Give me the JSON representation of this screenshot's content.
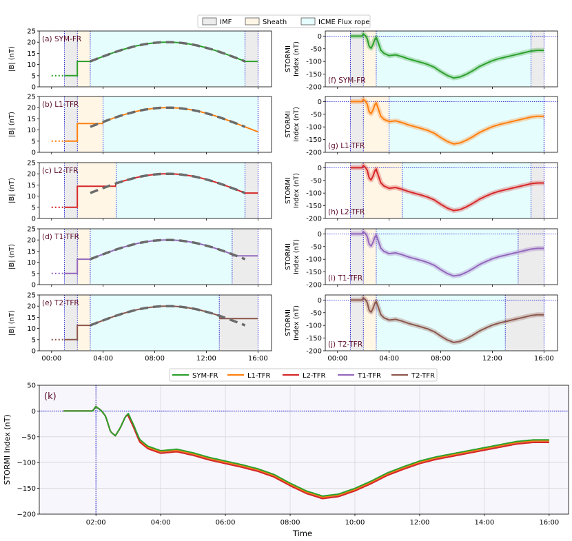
{
  "colors": {
    "imf": "#ececec",
    "sheath": "#fff6e6",
    "rope": "#e6fdfd",
    "kbg": "#f8f6fd",
    "SYM-FR": "#2ca02c",
    "L1-TFR": "#ff7f0e",
    "L2-TFR": "#d62728",
    "T1-TFR": "#9467bd",
    "T2-TFR": "#8c564b",
    "dashed": "#6b6b6b",
    "vline": "#0000cc",
    "label": "#5a0a2a"
  },
  "legend_top": [
    "IMF",
    "Sheath",
    "ICME Flux rope"
  ],
  "legend_bottom": [
    "SYM-FR",
    "L1-TFR",
    "L2-TFR",
    "T1-TFR",
    "T2-TFR"
  ],
  "chart_data": {
    "type": "line",
    "time_ticks": [
      "00:00",
      "04:00",
      "08:00",
      "12:00",
      "16:00"
    ],
    "k_time_ticks": [
      "02:00",
      "04:00",
      "06:00",
      "08:00",
      "10:00",
      "12:00",
      "14:00",
      "16:00"
    ],
    "b_axis": {
      "ylabel": "|B| (nT)",
      "yticks": [
        "0",
        "5",
        "10",
        "15",
        "20",
        "25"
      ],
      "ylim": [
        0,
        25
      ]
    },
    "stormi_axis": {
      "ylabel": [
        "STORMI",
        "Index (nT)"
      ],
      "yticks": [
        "0",
        "-50",
        "-100",
        "-150",
        "-200"
      ],
      "ylim": [
        -200,
        20
      ]
    },
    "k_axis": {
      "ylabel": "STORMI Index (nT)",
      "xlabel": "Time",
      "yticks": [
        "50",
        "0",
        "−50",
        "−100",
        "−150",
        "−200"
      ],
      "ylim": [
        -200,
        50
      ]
    },
    "panels": [
      {
        "b_label": "(a) SYM-FR",
        "s_label": "(f) SYM-FR",
        "model": "SYM-FR",
        "boundaries": [
          1,
          2,
          3,
          15,
          16
        ],
        "plateau": 11.4,
        "end_level": 11.4,
        "rope_start": 3,
        "rope_end": 15,
        "s_offset": 0
      },
      {
        "b_label": "(b) L1-TFR",
        "s_label": "(g) L1-TFR",
        "model": "L1-TFR",
        "boundaries": [
          1,
          2,
          4,
          16,
          16
        ],
        "plateau": 12.9,
        "end_level": 11.4,
        "rope_start": 4,
        "rope_end": 16,
        "s_offset": -2
      },
      {
        "b_label": "(c) L2-TFR",
        "s_label": "(h) L2-TFR",
        "model": "L2-TFR",
        "boundaries": [
          1,
          2,
          5,
          15,
          16
        ],
        "plateau": 14.4,
        "end_level": 11.4,
        "rope_start": 5,
        "rope_end": 15,
        "s_offset": -4
      },
      {
        "b_label": "(d) T1-TFR",
        "s_label": "(i) T1-TFR",
        "model": "T1-TFR",
        "boundaries": [
          1,
          2,
          3,
          14,
          16
        ],
        "plateau": 11.4,
        "end_level": 12.9,
        "rope_start": 3,
        "rope_end": 14,
        "s_offset": -1
      },
      {
        "b_label": "(e) T2-TFR",
        "s_label": "(j) T2-TFR",
        "model": "T2-TFR",
        "boundaries": [
          1,
          2,
          3,
          13,
          16
        ],
        "plateau": 11.4,
        "end_level": 14.4,
        "rope_start": 3,
        "rope_end": 13,
        "s_offset": -2
      }
    ],
    "b_profile": {
      "pre_level": 5.0,
      "peak": 20.0,
      "peak_time": 9,
      "dashed_from": 3,
      "dashed_to": 16
    },
    "stormi_common": {
      "x": [
        1.0,
        1.5,
        1.9,
        2.0,
        2.05,
        2.15,
        2.3,
        2.45,
        2.6,
        2.75,
        2.9,
        3.0,
        3.15,
        3.35,
        3.6,
        4.0,
        4.5,
        5.0,
        5.5,
        6.0,
        6.5,
        7.0,
        7.5,
        8.0,
        8.5,
        9.0,
        9.5,
        10.0,
        10.5,
        11.0,
        11.5,
        12.0,
        12.5,
        13.0,
        13.5,
        14.0,
        14.5,
        15.0,
        15.5,
        16.0
      ],
      "y": [
        0,
        0,
        0,
        9,
        6,
        2,
        -10,
        -40,
        -48,
        -33,
        -12,
        -5,
        -25,
        -55,
        -68,
        -77,
        -74,
        -81,
        -90,
        -97,
        -104,
        -112,
        -123,
        -140,
        -155,
        -165,
        -161,
        -150,
        -136,
        -120,
        -108,
        -97,
        -89,
        -83,
        -77,
        -71,
        -65,
        -59,
        -56,
        -56
      ]
    },
    "k_offsets": {
      "SYM-FR": 0,
      "L1-TFR": -2,
      "L2-TFR": -5,
      "T1-TFR": -3,
      "T2-TFR": -1.5
    }
  }
}
